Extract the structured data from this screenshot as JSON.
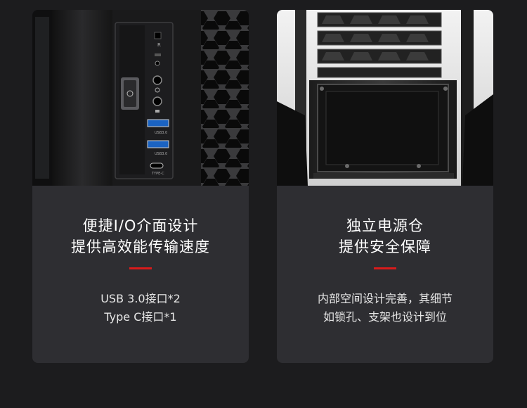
{
  "colors": {
    "background": "#1c1c1e",
    "card": "#2e2e32",
    "accent": "#d81b1b",
    "text": "#ffffff",
    "subtext": "#e6e6e6"
  },
  "cards": [
    {
      "image_icon": "front-io-panel-photo",
      "title_lines": [
        "便捷I/O介面设计",
        "提供高效能传输速度"
      ],
      "desc_lines": [
        "USB 3.0接口*2",
        "Type C接口*1"
      ]
    },
    {
      "image_icon": "psu-compartment-photo",
      "title_lines": [
        "独立电源仓",
        "提供安全保障"
      ],
      "desc_lines": [
        "内部空间设计完善，其细节",
        "如锁孔、支架也设计到位"
      ]
    }
  ]
}
